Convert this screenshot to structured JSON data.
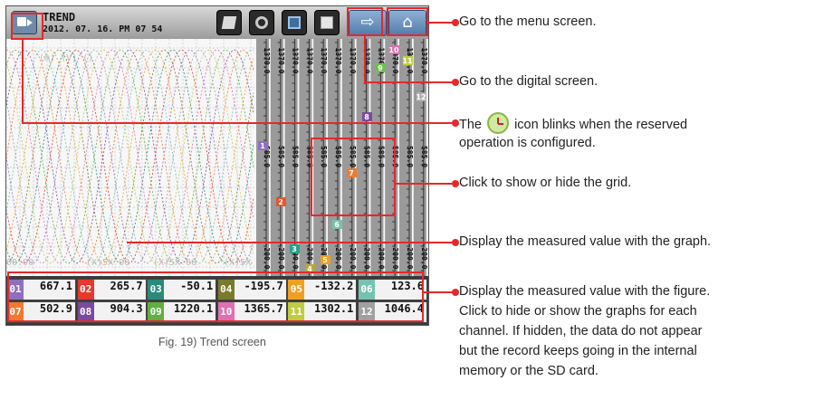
{
  "header": {
    "title": "TREND",
    "datetime": "2012. 07. 16. PM 07 54",
    "buttons": [
      "edit-icon",
      "reserve-icon",
      "window-icon",
      "save-icon"
    ],
    "digital_button_glyph": "⇨",
    "menu_button_glyph": "⌂"
  },
  "plot": {
    "scale_top_label": "1370.0",
    "scale_mid_label": "585.0",
    "scale_bottom_label": "-200.0",
    "axis_scale_count": 12,
    "overlay_texts": [
      "(m) (V) ()",
      "00:00",
      "(X)5X 00",
      "(X)5X 00",
      "(X)5X"
    ],
    "markers": [
      {
        "label": "1",
        "color": "#8e6fc0"
      },
      {
        "label": "2",
        "color": "#e8572b"
      },
      {
        "label": "3",
        "color": "#2aa08a"
      },
      {
        "label": "4",
        "color": "#b5a83a"
      },
      {
        "label": "5",
        "color": "#f0a020"
      },
      {
        "label": "6",
        "color": "#76c2b0"
      },
      {
        "label": "7",
        "color": "#f07a30"
      },
      {
        "label": "8",
        "color": "#7a4a9c"
      },
      {
        "label": "9",
        "color": "#6fc04a"
      },
      {
        "label": "10",
        "color": "#e070b0"
      },
      {
        "label": "11",
        "color": "#c0cc40"
      },
      {
        "label": "12",
        "color": "#b0b0b0"
      }
    ]
  },
  "channels": [
    {
      "num": "01",
      "value": "667.1",
      "color": "#8e6fc0"
    },
    {
      "num": "02",
      "value": "265.7",
      "color": "#e8372b"
    },
    {
      "num": "03",
      "value": "-50.1",
      "color": "#2a8a7a"
    },
    {
      "num": "04",
      "value": "-195.7",
      "color": "#7a7a2a"
    },
    {
      "num": "05",
      "value": "-132.2",
      "color": "#f0a020"
    },
    {
      "num": "06",
      "value": "123.6",
      "color": "#76c2b0"
    },
    {
      "num": "07",
      "value": "502.9",
      "color": "#f07a30"
    },
    {
      "num": "08",
      "value": "904.3",
      "color": "#7a4a9c"
    },
    {
      "num": "09",
      "value": "1220.1",
      "color": "#5fb040"
    },
    {
      "num": "10",
      "value": "1365.7",
      "color": "#e070b0"
    },
    {
      "num": "11",
      "value": "1302.1",
      "color": "#c0cc40"
    },
    {
      "num": "12",
      "value": "1046.4",
      "color": "#a0a0a0"
    }
  ],
  "captions": {
    "menu": "Go to the menu screen.",
    "digital": "Go to the digital screen.",
    "reserve_before": "The",
    "reserve_after": "icon blinks when the reserved",
    "reserve_line2": "operation is configured.",
    "grid": "Click to show or hide the grid.",
    "graph": "Display the measured value with the graph.",
    "figure_1": "Display the measured value with the figure.",
    "figure_2": "Click to hide or show the graphs for each",
    "figure_3": "channel. If hidden, the data do not appear",
    "figure_4": "but the record keeps going in the internal",
    "figure_5": "memory or the SD card."
  },
  "figure_caption": "Fig. 19) Trend screen",
  "colors": {
    "annotation": "#e8272b",
    "nav_button": "#5f87b5"
  }
}
